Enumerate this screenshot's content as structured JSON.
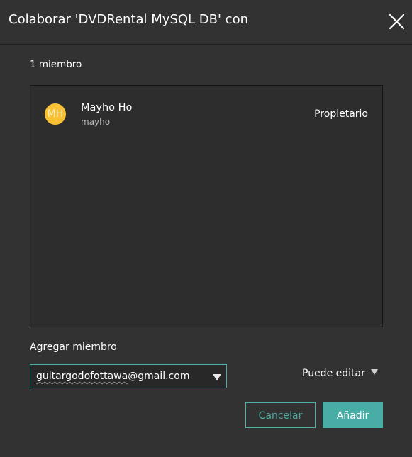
{
  "dialog": {
    "title": "Colaborar 'DVDRental MySQL DB' con",
    "close_icon": "close-icon"
  },
  "members": {
    "count_label": "1 miembro",
    "items": [
      {
        "initials": "MH",
        "name": "Mayho Ho",
        "username": "mayho",
        "role": "Propietario",
        "avatar_color": "#f7c133"
      }
    ]
  },
  "add_member": {
    "label": "Agregar miembro",
    "email_value_main": "guitargodofottawa",
    "email_value_suffix": "@gmail.com",
    "email_dropdown_icon": "caret-down-icon",
    "permission_value": "Puede editar",
    "permission_dropdown_icon": "caret-down-icon"
  },
  "buttons": {
    "cancel_label": "Cancelar",
    "add_label": "Añadir"
  },
  "colors": {
    "background": "#323232",
    "panel": "#2d2d2d",
    "accent": "#48ada5",
    "accent_text": "#52a7a0",
    "avatar": "#f7c133"
  }
}
